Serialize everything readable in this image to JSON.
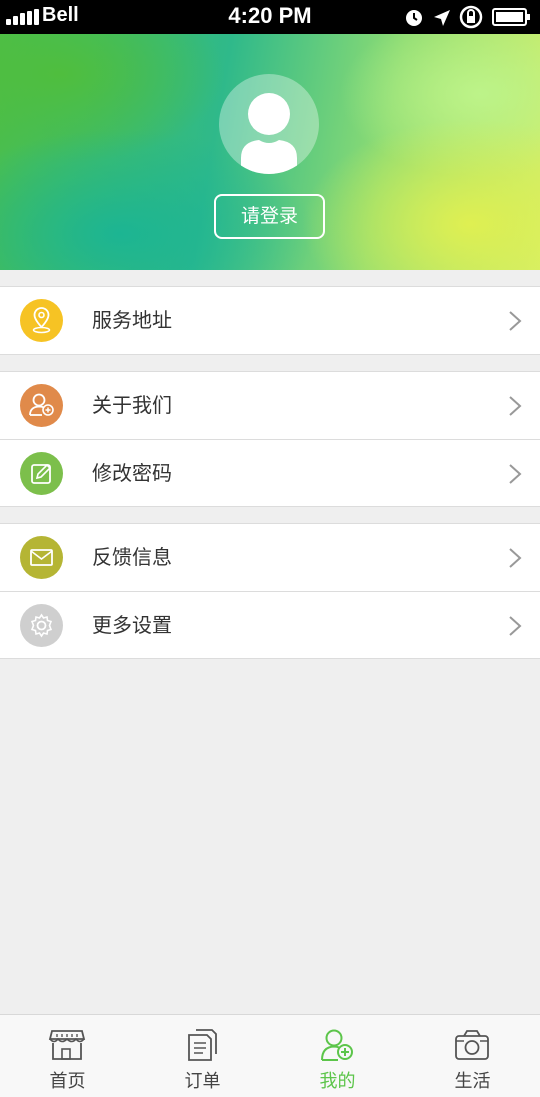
{
  "status_bar": {
    "carrier": "Bell",
    "time": "4:20 PM"
  },
  "header": {
    "login_label": "请登录"
  },
  "menu": {
    "service_address": {
      "label": "服务地址",
      "icon": "location-pin-icon",
      "color": "#f6c324"
    },
    "about_us": {
      "label": "关于我们",
      "icon": "user-add-icon",
      "color": "#e08a4a"
    },
    "change_password": {
      "label": "修改密码",
      "icon": "edit-icon",
      "color": "#7cbf4b"
    },
    "feedback": {
      "label": "反馈信息",
      "icon": "mail-icon",
      "color": "#b5b534"
    },
    "more_settings": {
      "label": "更多设置",
      "icon": "gear-icon",
      "color": "#cfcfcf"
    }
  },
  "tabs": [
    {
      "label": "首页",
      "icon": "storefront-icon",
      "active": false
    },
    {
      "label": "订单",
      "icon": "document-icon",
      "active": false
    },
    {
      "label": "我的",
      "icon": "user-add-icon",
      "active": true
    },
    {
      "label": "生活",
      "icon": "camera-icon",
      "active": false
    }
  ],
  "colors": {
    "accent": "#5cc54a",
    "background": "#efefef"
  }
}
